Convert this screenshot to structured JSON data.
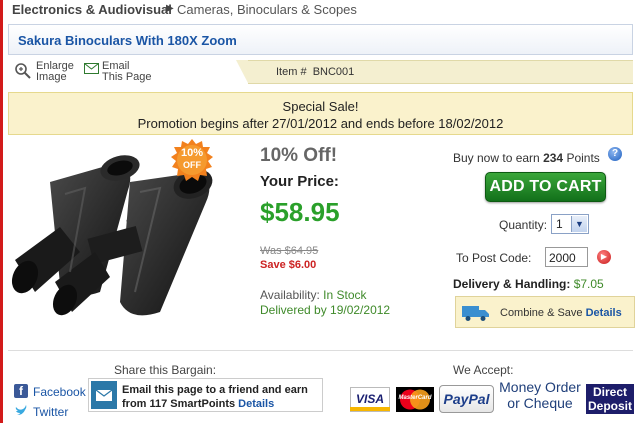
{
  "breadcrumb": {
    "category": "Electronics & Audiovisual",
    "subcategory": "Cameras, Binoculars & Scopes"
  },
  "product": {
    "title": "Sakura Binoculars With 180X Zoom",
    "item_label": "Item #",
    "item_number": "BNC001",
    "discount_badge_pct": "10%",
    "discount_badge_off": "OFF",
    "discount_heading": "10% Off!",
    "your_price_label": "Your Price:",
    "price": "$58.95",
    "was_price": "Was $64.95",
    "save_amount": "Save $6.00",
    "availability_label": "Availability:",
    "availability_value": "In Stock",
    "delivered_by": "Delivered by 19/02/2012"
  },
  "tools": {
    "enlarge_l1": "Enlarge",
    "enlarge_l2": "Image",
    "email_l1": "Email",
    "email_l2": "This Page"
  },
  "promo": {
    "line1": "Special Sale!",
    "line2": "Promotion begins after 27/01/2012 and ends before 18/02/2012"
  },
  "purchase": {
    "earn_prefix": "Buy now to earn",
    "earn_points": "234",
    "earn_suffix": "Points",
    "add_to_cart": "ADD TO CART",
    "quantity_label": "Quantity:",
    "quantity_value": "1",
    "postcode_label": "To Post Code:",
    "postcode_value": "2000",
    "delivery_label": "Delivery & Handling:",
    "delivery_value": "$7.05",
    "combine_text": "Combine & Save",
    "combine_link": "Details"
  },
  "share": {
    "heading": "Share this Bargain:",
    "facebook": "Facebook",
    "twitter": "Twitter",
    "email_line1": "Email this page to a friend and earn",
    "email_line2": "from 117 SmartPoints",
    "email_link": "Details"
  },
  "payment": {
    "heading": "We Accept:",
    "visa": "VISA",
    "mastercard": "MasterCard",
    "paypal": "PayPal",
    "money_order_l1": "Money Order",
    "money_order_l2": "or Cheque",
    "direct_l1": "Direct",
    "direct_l2": "Deposit"
  },
  "colors": {
    "accent_blue": "#1a55a5",
    "price_green": "#2aa02a",
    "save_red": "#cc2222",
    "promo_bg": "#faf2cc",
    "cart_green": "#12701a"
  }
}
